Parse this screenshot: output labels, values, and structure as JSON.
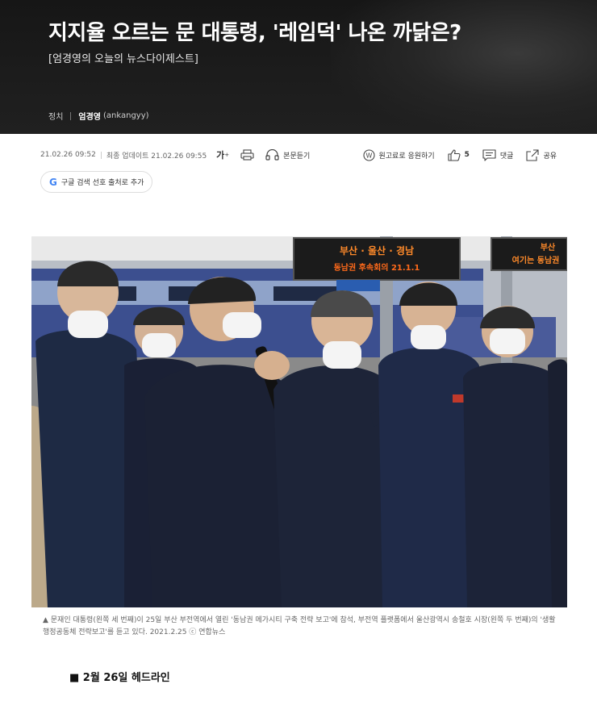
{
  "header": {
    "title": "지지율 오르는 문 대통령, '레임덕' 나온 까닭은?",
    "subtitle": "[엄경영의 오늘의 뉴스다이제스트]",
    "section": "정치",
    "author_name": "엄경영",
    "author_id": "(ankangyy)"
  },
  "toolbar": {
    "published": "21.02.26 09:52",
    "updated": "최종 업데이트 21.02.26 09:55",
    "font_size_label": "가",
    "listen_label": "본문듣기",
    "support_label": "원고료로 응원하기",
    "like_count": "5",
    "comment_label": "댓글",
    "share_label": "공유"
  },
  "google_button": {
    "label": "구글 검색 선호 출처로 추가",
    "logo_letter": "G"
  },
  "photo": {
    "sign_left": "부산 · 울산 · 경남",
    "sign_left_2": "동남권 후속회의 21.1.1",
    "sign_right": "부산",
    "sign_right_2": "여기는 동남권"
  },
  "caption": {
    "text": "▲  문재인 대통령(왼쪽 세 번째)이 25일 부산 부전역에서 열린 '동남권 메가시티 구축 전략 보고'에 참석, 부전역 플랫폼에서 울산광역시 송철호 시장(왼쪽 두 번째)의 '생활 행정공동체 전략보고'를 듣고 있다. 2021.2.25  ⓒ 연합뉴스"
  },
  "body": {
    "headline": "■ 2월 26일 헤드라인"
  },
  "colors": {
    "hero_bg": "#1a1a1a",
    "jacket": "#1c2333",
    "led": "#ff7a1a"
  }
}
